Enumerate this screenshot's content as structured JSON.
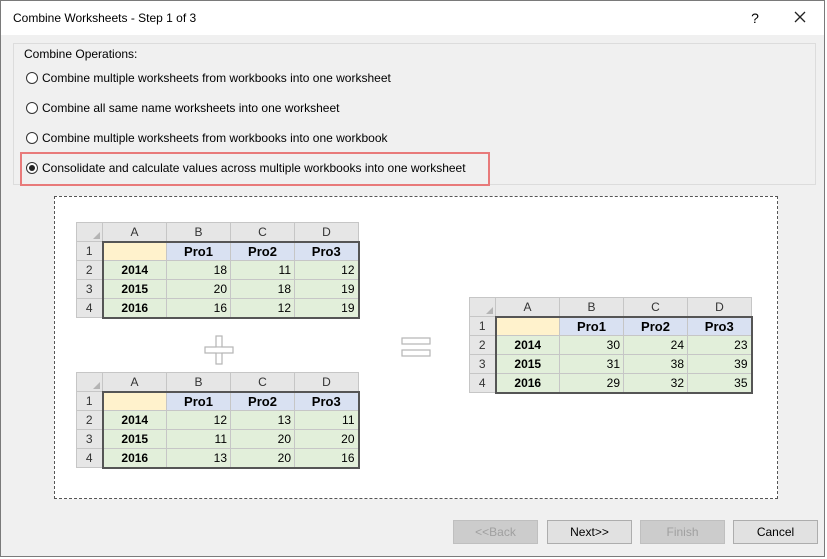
{
  "window": {
    "title": "Combine Worksheets - Step 1 of 3",
    "help": "?"
  },
  "group": {
    "label": "Combine Operations:",
    "options": [
      {
        "label": "Combine multiple worksheets from workbooks into one worksheet",
        "checked": false
      },
      {
        "label": "Combine all same name worksheets into one worksheet",
        "checked": false
      },
      {
        "label": "Combine multiple worksheets from workbooks into one workbook",
        "checked": false
      },
      {
        "label": "Consolidate and calculate values across multiple workbooks into one worksheet",
        "checked": true
      }
    ]
  },
  "sheets": {
    "columns": [
      "A",
      "B",
      "C",
      "D"
    ],
    "row_numbers": [
      "1",
      "2",
      "3",
      "4"
    ],
    "headers": [
      "Pro1",
      "Pro2",
      "Pro3"
    ],
    "first": [
      {
        "year": "2014",
        "values": [
          "18",
          "11",
          "12"
        ]
      },
      {
        "year": "2015",
        "values": [
          "20",
          "18",
          "19"
        ]
      },
      {
        "year": "2016",
        "values": [
          "16",
          "12",
          "19"
        ]
      }
    ],
    "second": [
      {
        "year": "2014",
        "values": [
          "12",
          "13",
          "11"
        ]
      },
      {
        "year": "2015",
        "values": [
          "11",
          "20",
          "20"
        ]
      },
      {
        "year": "2016",
        "values": [
          "13",
          "20",
          "16"
        ]
      }
    ],
    "result": [
      {
        "year": "2014",
        "values": [
          "30",
          "24",
          "23"
        ]
      },
      {
        "year": "2015",
        "values": [
          "31",
          "38",
          "39"
        ]
      },
      {
        "year": "2016",
        "values": [
          "29",
          "32",
          "35"
        ]
      }
    ]
  },
  "buttons": {
    "back": "<<Back",
    "next": "Next>>",
    "finish": "Finish",
    "cancel": "Cancel"
  }
}
